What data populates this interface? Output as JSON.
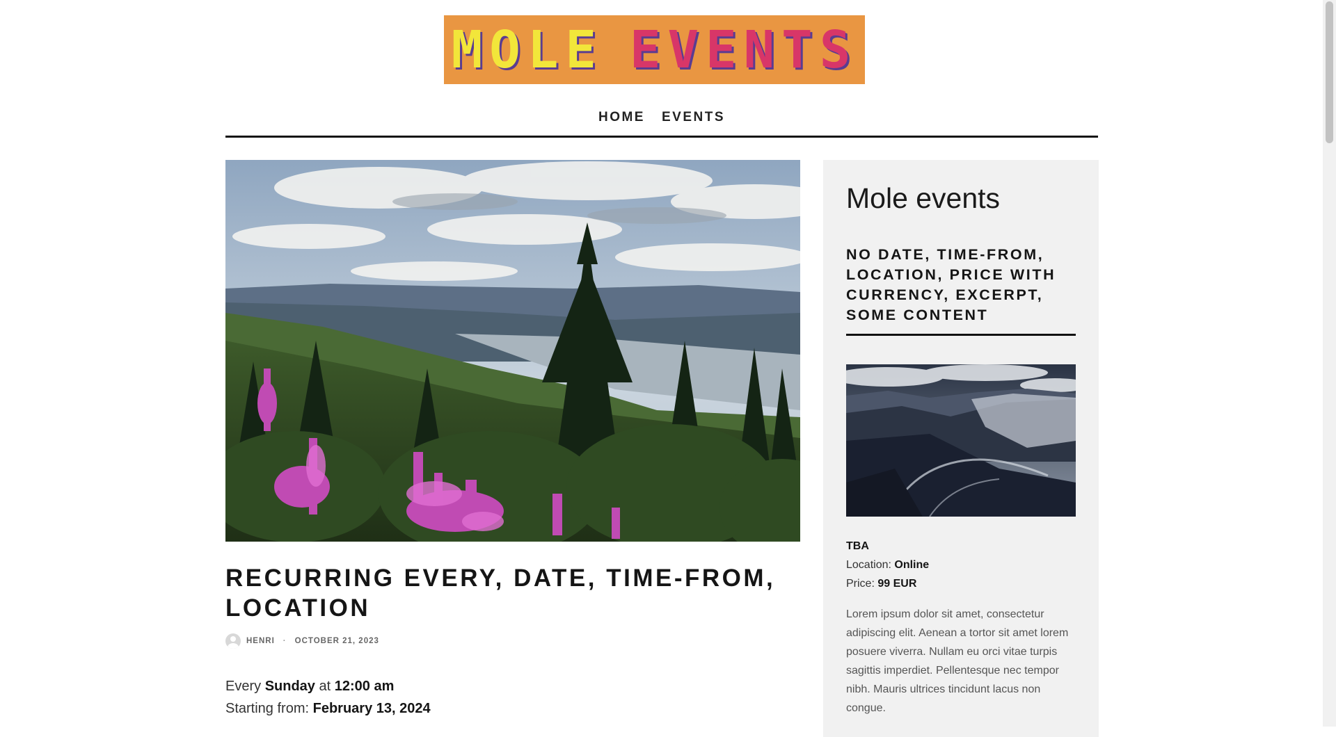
{
  "site": {
    "logo_word1": "MOLE",
    "logo_word2": "EVENTS",
    "logo_colors": {
      "background": "#e99642",
      "word1": "#f2e63a",
      "word2": "#d83668",
      "shadow": "#5a3c91"
    }
  },
  "nav": {
    "items": [
      {
        "label": "HOME"
      },
      {
        "label": "EVENTS"
      }
    ]
  },
  "post": {
    "title": "RECURRING EVERY, DATE, TIME-FROM, LOCATION",
    "author": "HENRI",
    "separator": "·",
    "date": "OCTOBER 21, 2023",
    "event": {
      "every_label": "Every",
      "day": "Sunday",
      "at_label": "at",
      "time": "12:00 am",
      "starting_label": "Starting from:",
      "start_date": "February 13, 2024"
    }
  },
  "sidebar": {
    "title": "Mole events",
    "event_title": "NO DATE, TIME-FROM, LOCATION, PRICE WITH CURRENCY, EXCERPT, SOME CONTENT",
    "date": "TBA",
    "location_label": "Location:",
    "location": "Online",
    "price_label": "Price:",
    "price": "99 EUR",
    "excerpt": "Lorem ipsum dolor sit amet, consectetur adipiscing elit. Aenean a tortor sit amet lorem posuere viverra. Nullam eu orci vitae turpis sagittis imperdiet. Pellentesque nec tempor nibh. Mauris ultrices tincidunt lacus non congue."
  }
}
